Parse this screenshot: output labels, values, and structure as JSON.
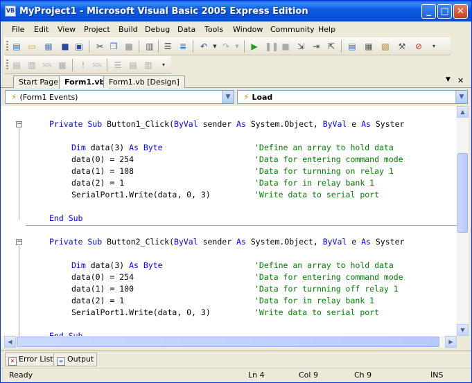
{
  "window": {
    "title": "MyProject1 - Microsoft Visual Basic 2005 Express Edition",
    "icon_label": "VB",
    "controls": {
      "minimize": "_",
      "maximize": "□",
      "close": "✕"
    }
  },
  "menu": {
    "items": [
      "File",
      "Edit",
      "View",
      "Project",
      "Build",
      "Debug",
      "Data",
      "Tools",
      "Window",
      "Community",
      "Help"
    ]
  },
  "toolbar1": {
    "icons": [
      "add-item-icon",
      "open-icon",
      "add-icon",
      "save-icon",
      "save-all-icon",
      "cut-icon",
      "copy-icon",
      "paste-icon",
      "find-icon",
      "comment-icon",
      "uncomment-icon",
      "undo-icon",
      "redo-icon",
      "start-debug-icon",
      "pause-icon",
      "stop-icon",
      "step-into-icon",
      "step-over-icon",
      "step-out-icon",
      "solution-explorer-icon",
      "properties-icon",
      "object-browser-icon",
      "toolbox-icon",
      "options-icon"
    ]
  },
  "tabs": {
    "items": [
      {
        "label": "Start Page",
        "active": false
      },
      {
        "label": "Form1.vb",
        "active": true
      },
      {
        "label": "Form1.vb [Design]",
        "active": false
      }
    ],
    "dropdown_glyph": "▼",
    "close_glyph": "✕"
  },
  "combos": {
    "left": "(Form1 Events)",
    "right": "Load"
  },
  "code": {
    "sub1": {
      "keyword_private": "Private Sub",
      "name": " Button1_Click(",
      "byval1": "ByVal",
      "sender": " sender ",
      "as1": "As",
      "type1": " System.Object, ",
      "byval2": "ByVal",
      "e": " e ",
      "as2": "As",
      "type2": " Syster",
      "lines": [
        {
          "kw": "Dim",
          "code": " data(3) ",
          "kw2": "As Byte",
          "comment": "'Define an array to hold data"
        },
        {
          "kw": "",
          "code": "data(0) = 254",
          "kw2": "",
          "comment": "'Data for entering command mode"
        },
        {
          "kw": "",
          "code": "data(1) = 108",
          "kw2": "",
          "comment": "'Data for turnning on relay 1"
        },
        {
          "kw": "",
          "code": "data(2) = 1",
          "kw2": "",
          "comment": "'Data for in relay bank 1"
        },
        {
          "kw": "",
          "code": "SerialPort1.Write(data, 0, 3)",
          "kw2": "",
          "comment": "'Write data to serial port"
        }
      ],
      "end": "End Sub"
    },
    "sub2": {
      "keyword_private": "Private Sub",
      "name": " Button2_Click(",
      "byval1": "ByVal",
      "sender": " sender ",
      "as1": "As",
      "type1": " System.Object, ",
      "byval2": "ByVal",
      "e": " e ",
      "as2": "As",
      "type2": " Syster",
      "lines": [
        {
          "kw": "Dim",
          "code": " data(3) ",
          "kw2": "As Byte",
          "comment": "'Define an array to hold data"
        },
        {
          "kw": "",
          "code": "data(0) = 254",
          "kw2": "",
          "comment": "'Data for entering command mode"
        },
        {
          "kw": "",
          "code": "data(1) = 100",
          "kw2": "",
          "comment": "'Data for turnning off relay 1"
        },
        {
          "kw": "",
          "code": "data(2) = 1",
          "kw2": "",
          "comment": "'Data for in relay bank 1"
        },
        {
          "kw": "",
          "code": "SerialPort1.Write(data, 0, 3)",
          "kw2": "",
          "comment": "'Write data to serial port"
        }
      ],
      "end": "End Sub"
    }
  },
  "bottom_tabs": [
    "Error List",
    "Output"
  ],
  "status": {
    "text": "Ready",
    "ln": "Ln 4",
    "col": "Col 9",
    "ch": "Ch 9",
    "mode": "INS"
  },
  "colors": {
    "keyword": "#0000ff",
    "comment": "#008000",
    "titlebar": "#0451d6"
  }
}
